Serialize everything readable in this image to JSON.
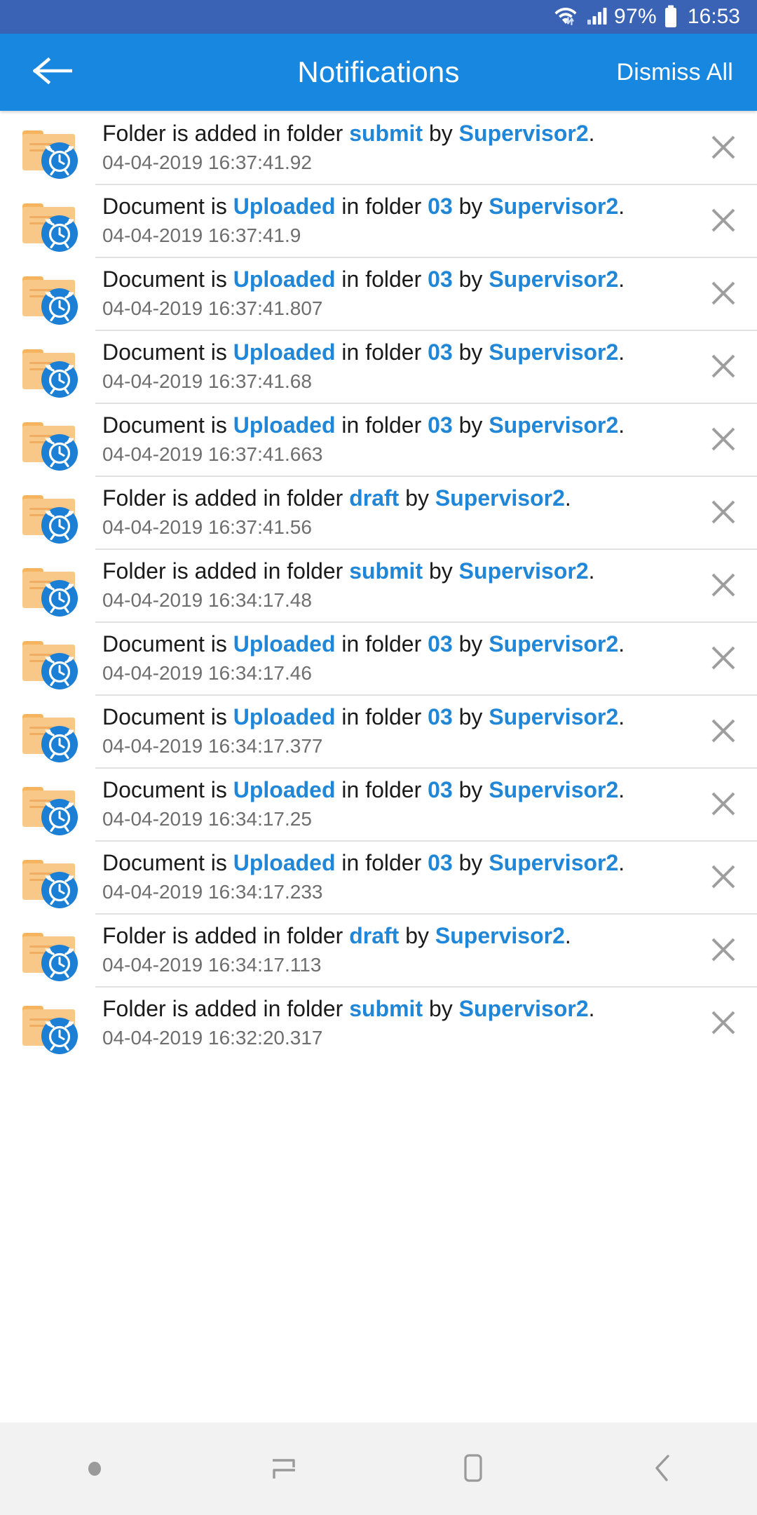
{
  "status_bar": {
    "background": "#3a62b5",
    "wifi_icon": "wifi-with-transfer-arrows-icon",
    "signal_icon": "cellular-signal-icon",
    "battery_percent": "97%",
    "battery_icon": "battery-full-icon",
    "time": "16:53"
  },
  "app_bar": {
    "background": "#1787e0",
    "back_icon": "arrow-left-icon",
    "title": "Notifications",
    "dismiss_all_label": "Dismiss All"
  },
  "accent_color": "#2086d8",
  "list": {
    "item_icon": "folder-with-alarm-clock-icon",
    "close_icon": "close-x-icon",
    "items": [
      {
        "prefix": "Folder is added in folder ",
        "target": "submit",
        "middle": " by ",
        "actor": "Supervisor2",
        "suffix": ".",
        "timestamp": "04-04-2019 16:37:41.92"
      },
      {
        "prefix": "Document is ",
        "action": "Uploaded",
        "between": " in folder ",
        "target": "03",
        "middle": " by ",
        "actor": "Supervisor2",
        "suffix": ".",
        "timestamp": "04-04-2019 16:37:41.9"
      },
      {
        "prefix": "Document is ",
        "action": "Uploaded",
        "between": " in folder ",
        "target": "03",
        "middle": " by ",
        "actor": "Supervisor2",
        "suffix": ".",
        "timestamp": "04-04-2019 16:37:41.807"
      },
      {
        "prefix": "Document is ",
        "action": "Uploaded",
        "between": " in folder ",
        "target": "03",
        "middle": " by ",
        "actor": "Supervisor2",
        "suffix": ".",
        "timestamp": "04-04-2019 16:37:41.68"
      },
      {
        "prefix": "Document is ",
        "action": "Uploaded",
        "between": " in folder ",
        "target": "03",
        "middle": " by ",
        "actor": "Supervisor2",
        "suffix": ".",
        "timestamp": "04-04-2019 16:37:41.663"
      },
      {
        "prefix": "Folder is added in folder ",
        "target": "draft",
        "middle": " by ",
        "actor": "Supervisor2",
        "suffix": ".",
        "timestamp": "04-04-2019 16:37:41.56"
      },
      {
        "prefix": "Folder is added in folder ",
        "target": "submit",
        "middle": " by ",
        "actor": "Supervisor2",
        "suffix": ".",
        "timestamp": "04-04-2019 16:34:17.48"
      },
      {
        "prefix": "Document is ",
        "action": "Uploaded",
        "between": " in folder ",
        "target": "03",
        "middle": " by ",
        "actor": "Supervisor2",
        "suffix": ".",
        "timestamp": "04-04-2019 16:34:17.46"
      },
      {
        "prefix": "Document is ",
        "action": "Uploaded",
        "between": " in folder ",
        "target": "03",
        "middle": " by ",
        "actor": "Supervisor2",
        "suffix": ".",
        "timestamp": "04-04-2019 16:34:17.377"
      },
      {
        "prefix": "Document is ",
        "action": "Uploaded",
        "between": " in folder ",
        "target": "03",
        "middle": " by ",
        "actor": "Supervisor2",
        "suffix": ".",
        "timestamp": "04-04-2019 16:34:17.25"
      },
      {
        "prefix": "Document is ",
        "action": "Uploaded",
        "between": " in folder ",
        "target": "03",
        "middle": " by ",
        "actor": "Supervisor2",
        "suffix": ".",
        "timestamp": "04-04-2019 16:34:17.233"
      },
      {
        "prefix": "Folder is added in folder ",
        "target": "draft",
        "middle": " by ",
        "actor": "Supervisor2",
        "suffix": ".",
        "timestamp": "04-04-2019 16:34:17.113"
      },
      {
        "prefix": "Folder is added in folder ",
        "target": "submit",
        "middle": " by ",
        "actor": "Supervisor2",
        "suffix": ".",
        "timestamp": "04-04-2019 16:32:20.317"
      }
    ]
  },
  "nav_bar": {
    "background": "#f2f2f2",
    "buttons": [
      {
        "icon": "menu-dot-icon"
      },
      {
        "icon": "recents-icon"
      },
      {
        "icon": "home-icon"
      },
      {
        "icon": "back-icon"
      }
    ]
  }
}
